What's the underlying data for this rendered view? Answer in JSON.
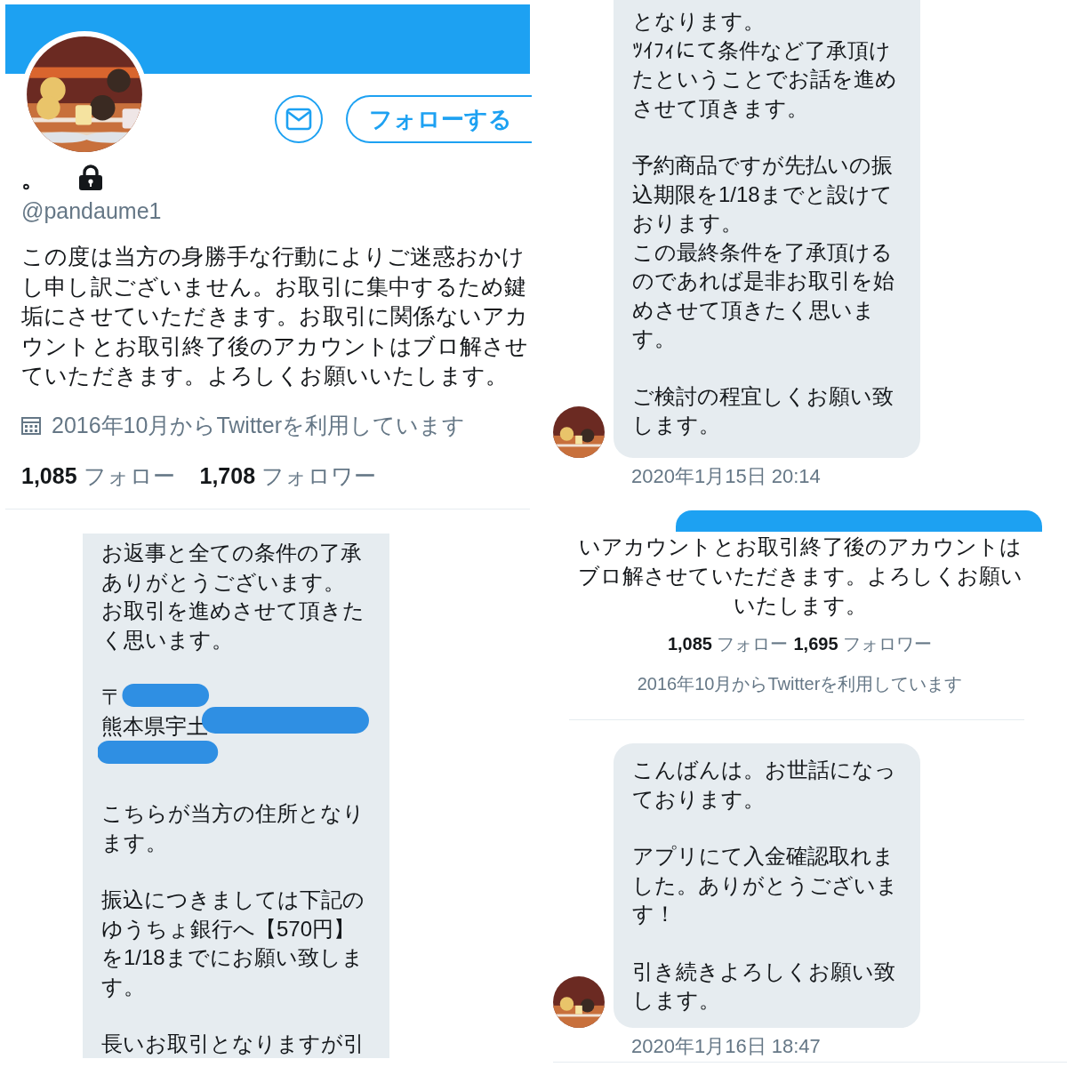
{
  "profile": {
    "follow_button": "フォローする",
    "name": "。",
    "protected": true,
    "handle": "@pandaume1",
    "bio": "この度は当方の身勝手な行動によりご迷惑おかけし申し訳ございません。お取引に集中するため鍵垢にさせていただきます。お取引に関係ないアカウントとお取引終了後のアカウントはブロ解させていただきます。よろしくお願いいたします。",
    "joined": "2016年10月からTwitterを利用しています",
    "stats": [
      {
        "count": "1,085",
        "label": "フォロー"
      },
      {
        "count": "1,708",
        "label": "フォロワー"
      }
    ]
  },
  "conversation_1": {
    "paragraphs": [
      {
        "kind": "text",
        "lines": [
          "お返事と全ての条件の了承ありがとうございます。",
          "お取引を進めさせて頂きたく思います。"
        ]
      },
      {
        "kind": "redacted",
        "lines": [
          "〒",
          "熊本県宇土"
        ]
      },
      {
        "kind": "text",
        "lines": [
          "こちらが当方の住所となります。"
        ]
      },
      {
        "kind": "text",
        "lines": [
          "振込につきましては下記のゆうちょ銀行へ【570円】を1/18までにお願い致します。"
        ]
      },
      {
        "kind": "text",
        "lines": [
          "長いお取引となりますが引"
        ]
      }
    ]
  },
  "conversation_2": {
    "paragraphs": [
      {
        "kind": "text",
        "lines": [
          "となります。",
          "ﾂｲﾌｨにて条件など了承頂けたということでお話を進めさせて頂きます。"
        ]
      },
      {
        "kind": "text",
        "lines": [
          "予約商品ですが先払いの振込期限を1/18までと設けております。",
          "この最終条件を了承頂けるのであれば是非お取引を始めさせて頂きたく思います。"
        ]
      },
      {
        "kind": "text",
        "lines": [
          "ご検討の程宜しくお願い致します。"
        ]
      }
    ],
    "timestamp": "2020年1月15日 20:14"
  },
  "conversation_3": {
    "profile_bio_end": "いアカウントとお取引終了後のアカウントはブロ解させていただきます。よろしくお願いいたします。",
    "stats": [
      {
        "count": "1,085",
        "label": "フォロー"
      },
      {
        "count": "1,695",
        "label": "フォロワー"
      }
    ],
    "joined": "2016年10月からTwitterを利用しています",
    "paragraphs": [
      {
        "kind": "text",
        "lines": [
          "こんばんは。お世話になっております。"
        ]
      },
      {
        "kind": "text",
        "lines": [
          "アプリにて入金確認取れました。ありがとうございます！"
        ]
      },
      {
        "kind": "text",
        "lines": [
          "引き続きよろしくお願い致します。"
        ]
      }
    ],
    "timestamp": "2020年1月16日 18:47"
  }
}
